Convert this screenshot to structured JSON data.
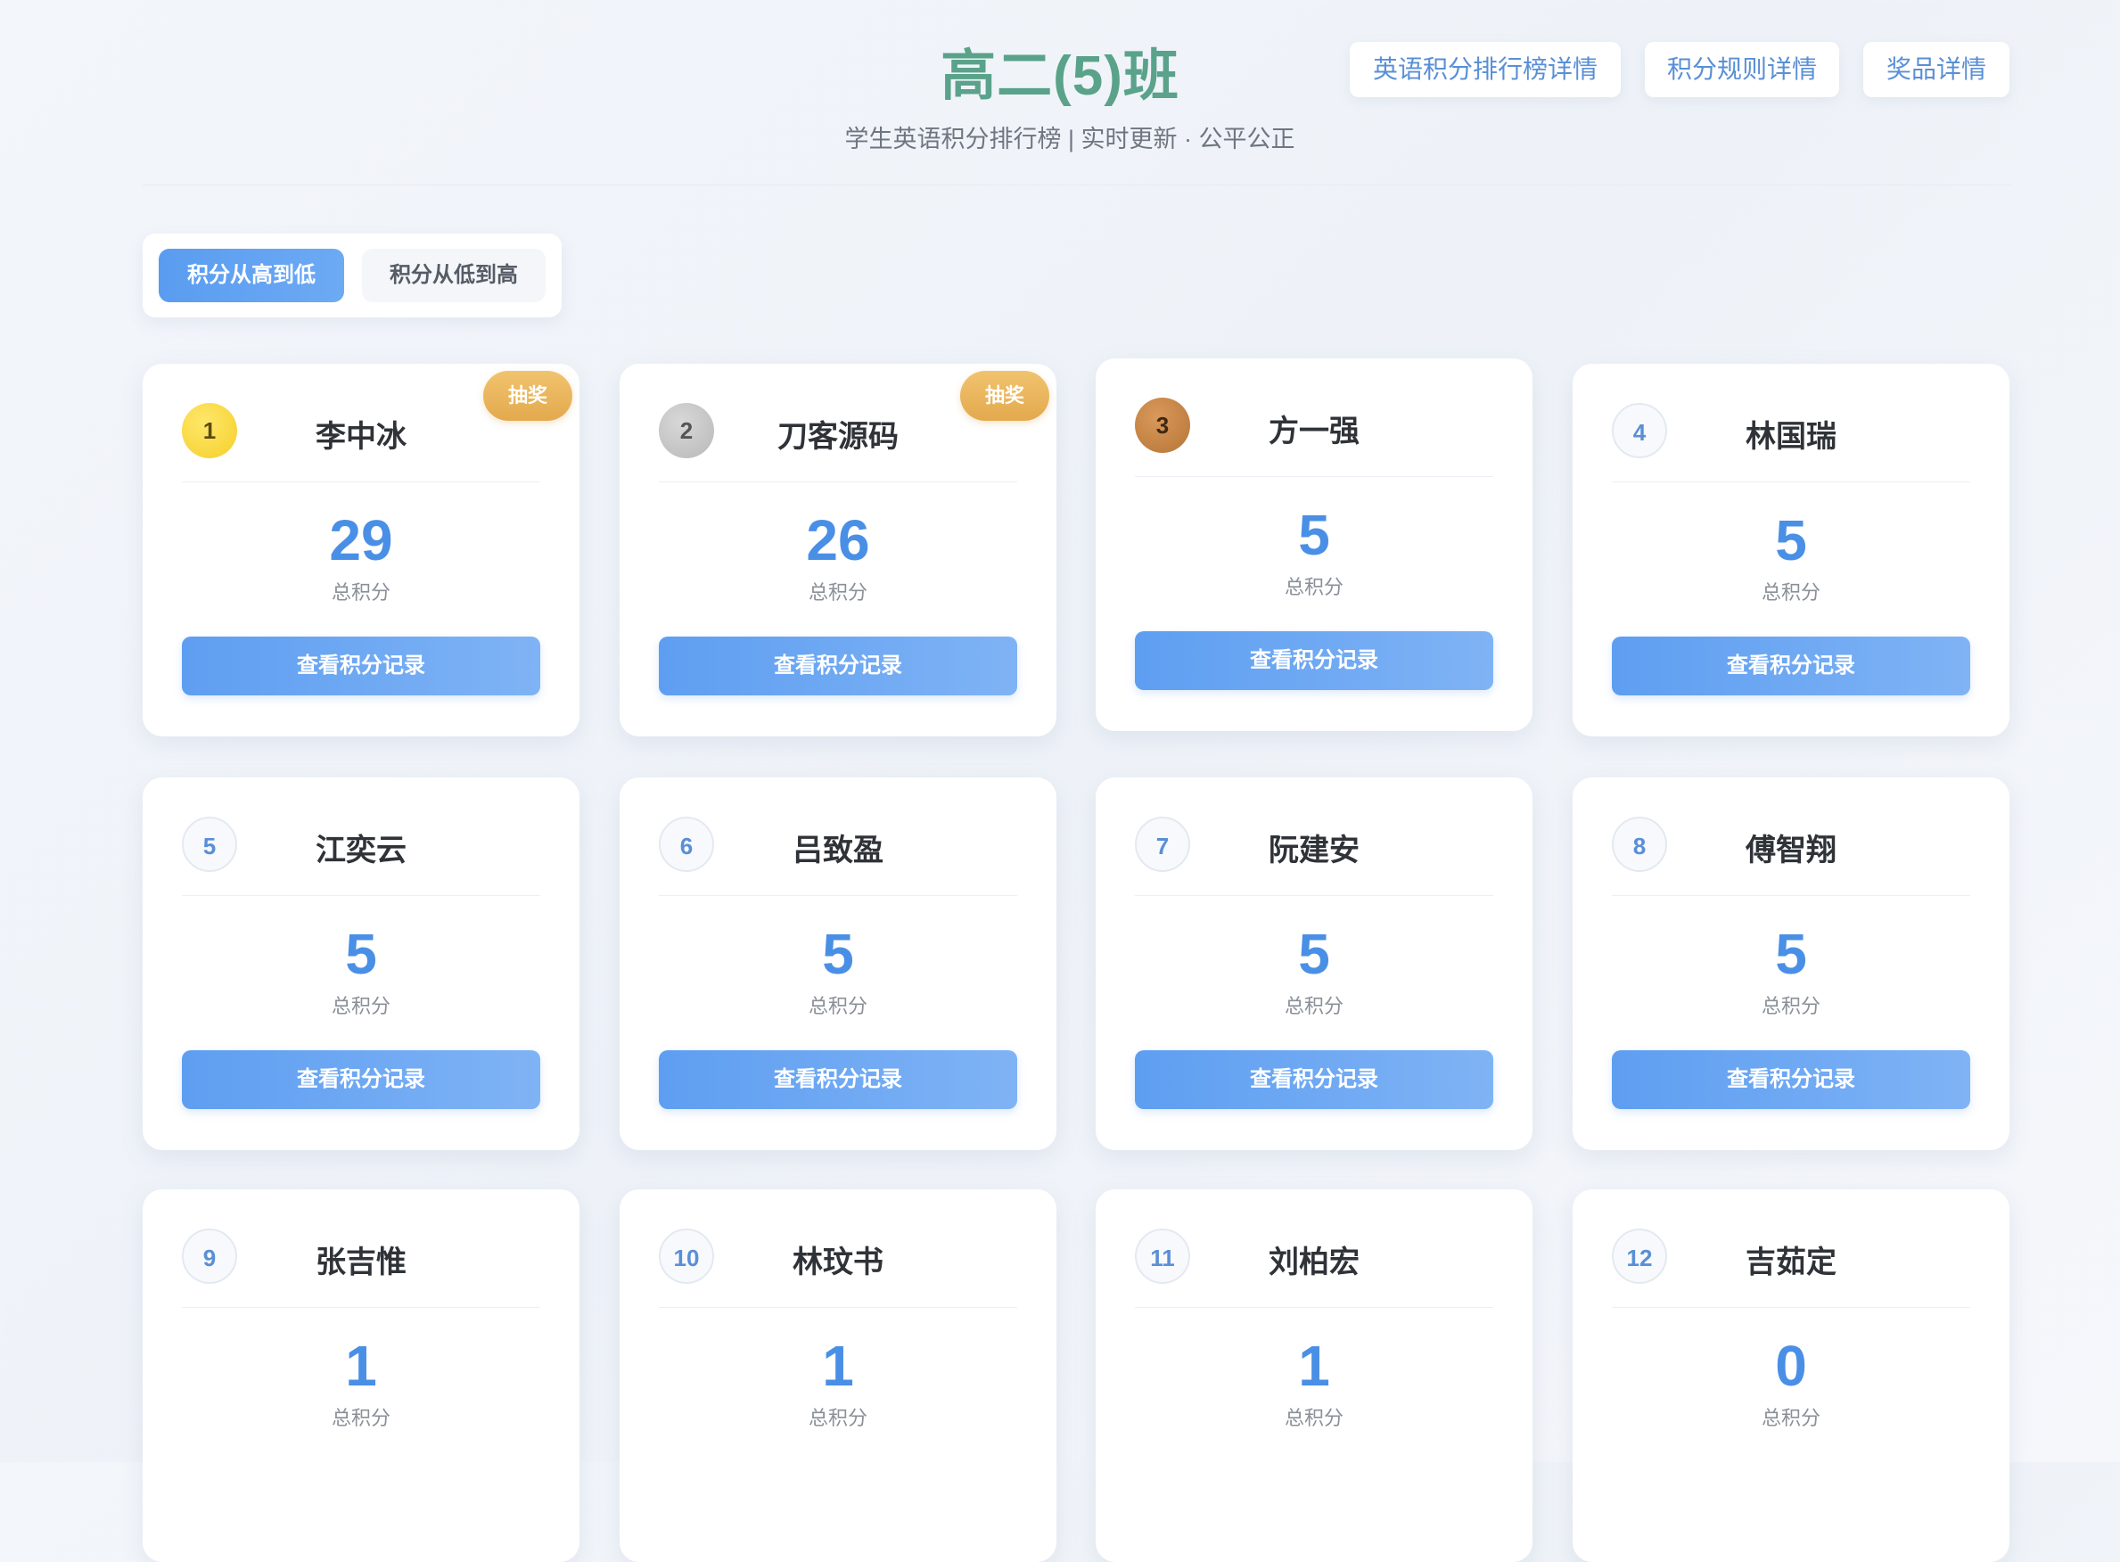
{
  "header": {
    "title": "高二(5)班",
    "subtitle": "学生英语积分排行榜 | 实时更新 · 公平公正",
    "buttons": [
      {
        "label": "英语积分排行榜详情"
      },
      {
        "label": "积分规则详情"
      },
      {
        "label": "奖品详情"
      }
    ]
  },
  "sort": {
    "active_label": "积分从高到低",
    "inactive_label": "积分从低到高"
  },
  "card_labels": {
    "score_label": "总积分",
    "record_button": "查看积分记录",
    "lottery_label": "抽奖"
  },
  "colors": {
    "title": "#5aa28a",
    "accent_blue": "#4a8fe6",
    "gold": "#f4cf2a",
    "silver": "#b8b8b8",
    "bronze": "#b67538",
    "lottery": "#e3a94e"
  },
  "students": [
    {
      "rank": "1",
      "name": "李中冰",
      "score": "29",
      "lottery": true,
      "medal": "gold"
    },
    {
      "rank": "2",
      "name": "刀客源码",
      "score": "26",
      "lottery": true,
      "medal": "silver"
    },
    {
      "rank": "3",
      "name": "方一强",
      "score": "5",
      "lottery": false,
      "medal": "bronze"
    },
    {
      "rank": "4",
      "name": "林国瑞",
      "score": "5",
      "lottery": false,
      "medal": "normal"
    },
    {
      "rank": "5",
      "name": "江奕云",
      "score": "5",
      "lottery": false,
      "medal": "normal"
    },
    {
      "rank": "6",
      "name": "吕致盈",
      "score": "5",
      "lottery": false,
      "medal": "normal"
    },
    {
      "rank": "7",
      "name": "阮建安",
      "score": "5",
      "lottery": false,
      "medal": "normal"
    },
    {
      "rank": "8",
      "name": "傅智翔",
      "score": "5",
      "lottery": false,
      "medal": "normal"
    },
    {
      "rank": "9",
      "name": "张吉惟",
      "score": "1",
      "lottery": false,
      "medal": "normal"
    },
    {
      "rank": "10",
      "name": "林玟书",
      "score": "1",
      "lottery": false,
      "medal": "normal"
    },
    {
      "rank": "11",
      "name": "刘柏宏",
      "score": "1",
      "lottery": false,
      "medal": "normal"
    },
    {
      "rank": "12",
      "name": "吉茹定",
      "score": "0",
      "lottery": false,
      "medal": "normal"
    }
  ]
}
